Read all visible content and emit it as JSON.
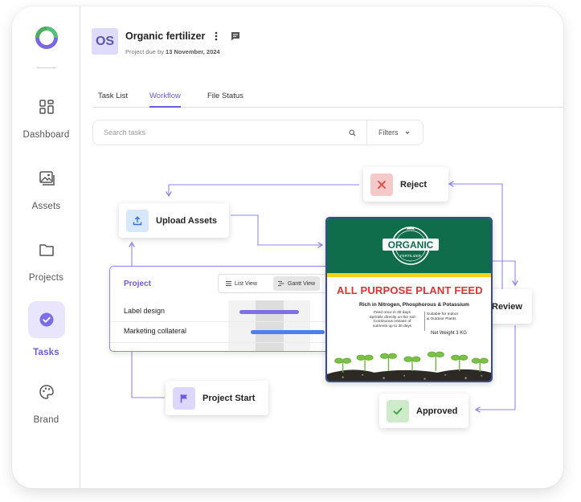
{
  "sidebar": {
    "items": [
      {
        "label": "Dashboard",
        "icon": "dashboard-grid-icon",
        "active": false
      },
      {
        "label": "Assets",
        "icon": "image-stack-icon",
        "active": false
      },
      {
        "label": "Projects",
        "icon": "folder-icon",
        "active": false
      },
      {
        "label": "Tasks",
        "icon": "check-circle-icon",
        "active": true
      },
      {
        "label": "Brand",
        "icon": "palette-icon",
        "active": false
      }
    ]
  },
  "header": {
    "avatar_initials": "OS",
    "project_title": "Organic fertilizer",
    "due_prefix": "Project due by",
    "due_date": "13 November, 2024"
  },
  "tabs": [
    {
      "label": "Task List",
      "active": false
    },
    {
      "label": "Workflow",
      "active": true
    },
    {
      "label": "File Status",
      "active": false
    }
  ],
  "search": {
    "placeholder": "Search tasks",
    "value": "",
    "filters_label": "Filters"
  },
  "workflow": {
    "nodes": {
      "upload": {
        "label": "Upload Assets",
        "icon": "upload-icon"
      },
      "reject": {
        "label": "Reject",
        "icon": "close-icon"
      },
      "review": {
        "label": "Review",
        "icon": "star-icon"
      },
      "approved": {
        "label": "Approved",
        "icon": "check-icon"
      },
      "start": {
        "label": "Project Start",
        "icon": "flag-icon"
      }
    },
    "gantt": {
      "title": "Project",
      "list_view_label": "List View",
      "gantt_view_label": "Gantt View",
      "tasks": [
        {
          "label": "Label design"
        },
        {
          "label": "Marketing collateral"
        }
      ]
    },
    "poster": {
      "headline": "ALL PURPOSE PLANT FEED",
      "subheadline": "Rich in Nitrogen, Phosphorous & Potassium",
      "instructions_left": "Feed once in 30 days\nSprinkle directly on the soil\nContinuous release of\nnutrients up to 30 days",
      "instructions_right": "Suitable for Indoor\n& Outdoor Plants",
      "weight": "Net Weight 3 KG",
      "logo_text": "ORGANIC",
      "logo_sub": "FERTILIZER"
    }
  },
  "colors": {
    "accent": "#6a5be2",
    "connector": "#8f85f0",
    "reject": "#e06464",
    "review": "#f2c046",
    "approved": "#63c26b",
    "poster_green": "#0f6d4b"
  }
}
